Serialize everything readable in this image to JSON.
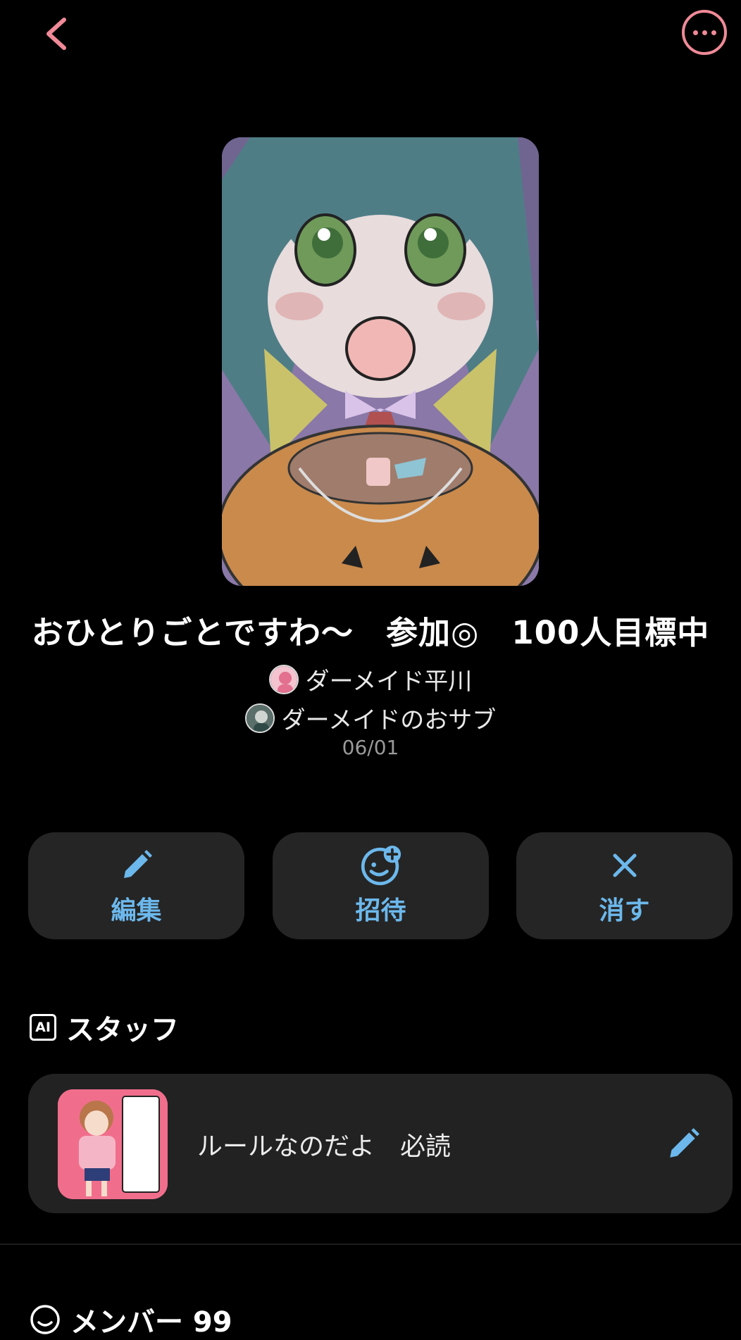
{
  "header": {
    "back_icon": "chevron-left-icon",
    "more_icon": "more-dots-icon",
    "accent": "#f08a98"
  },
  "circle": {
    "title": "おひとりごとですわ〜　参加◎　100人目標中",
    "hosts": [
      {
        "name": "ダーメイド平川"
      },
      {
        "name": "ダーメイドのおサブ"
      }
    ],
    "date": "06/01"
  },
  "actions": [
    {
      "label": "編集",
      "icon": "pencil-icon"
    },
    {
      "label": "招待",
      "icon": "add-friend-icon"
    },
    {
      "label": "消す",
      "icon": "close-icon"
    }
  ],
  "action_color": "#6cb8ec",
  "staff": {
    "badge": "AI",
    "heading": "スタッフ",
    "item": {
      "label": "ルールなのだよ　必読",
      "icon": "pencil-icon"
    }
  },
  "members": {
    "heading": "メンバー 99"
  }
}
